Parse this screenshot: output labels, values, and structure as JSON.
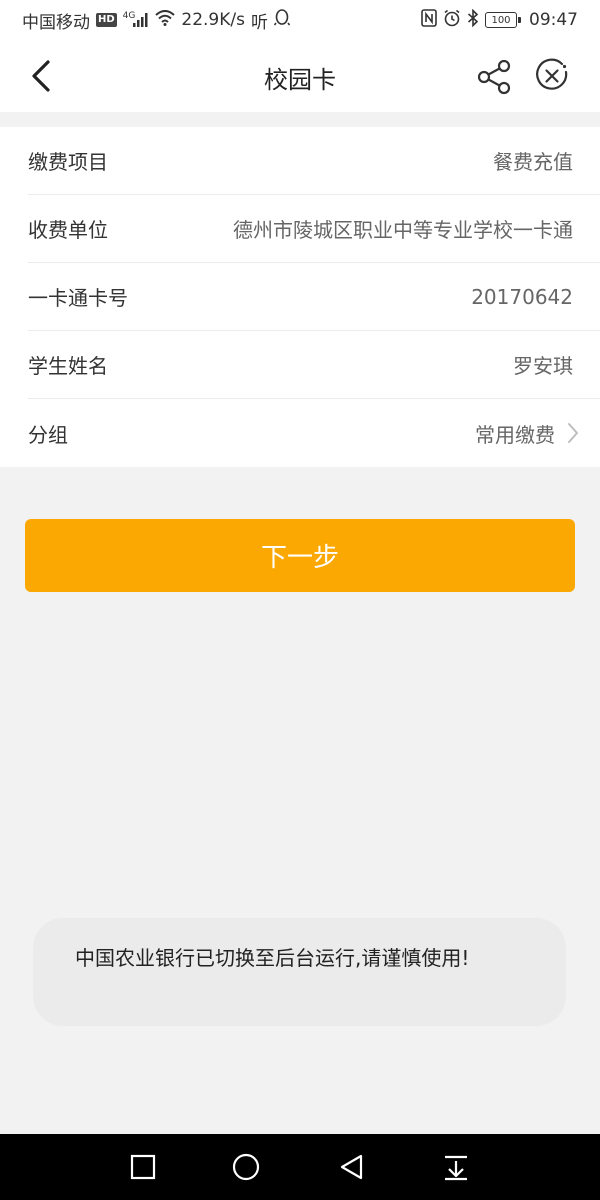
{
  "status_bar": {
    "carrier": "中国移动",
    "hd": "HD",
    "network": "4G",
    "speed": "22.9K/s",
    "listen": "听",
    "battery": "100",
    "time": "09:47"
  },
  "header": {
    "title": "校园卡",
    "back_icon": "chevron-left-icon",
    "share_icon": "share-icon",
    "close_icon": "close-circle-icon"
  },
  "form": {
    "rows": [
      {
        "label": "缴费项目",
        "value": "餐费充值"
      },
      {
        "label": "收费单位",
        "value": "德州市陵城区职业中等专业学校一卡通"
      },
      {
        "label": "一卡通卡号",
        "value": "20170642"
      },
      {
        "label": "学生姓名",
        "value": "罗安琪"
      },
      {
        "label": "分组",
        "value": "常用缴费"
      }
    ]
  },
  "actions": {
    "next_label": "下一步"
  },
  "toast": {
    "message": "中国农业银行已切换至后台运行,请谨慎使用!"
  },
  "system_nav": {
    "recent_icon": "square-icon",
    "home_icon": "circle-icon",
    "back_icon": "triangle-back-icon",
    "notification_icon": "pull-down-icon"
  },
  "colors": {
    "accent": "#fba802",
    "background": "#f2f2f2",
    "card": "#ffffff",
    "nav_bar": "#000000"
  }
}
